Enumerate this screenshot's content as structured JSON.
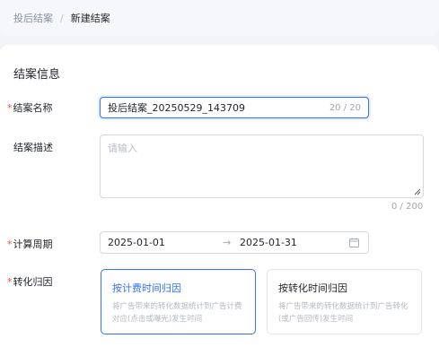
{
  "breadcrumb": {
    "parent": "投后结案",
    "separator": "/",
    "current": "新建结案"
  },
  "section": {
    "title": "结案信息"
  },
  "form": {
    "name": {
      "label": "结案名称",
      "required": "*",
      "value": "投后结案_20250529_143709",
      "count": "20 / 20"
    },
    "description": {
      "label": "结案描述",
      "placeholder": "请输入",
      "count": "0 / 200"
    },
    "period": {
      "label": "计算周期",
      "required": "*",
      "start": "2025-01-01",
      "arrow": "→",
      "end": "2025-01-31"
    },
    "attribution": {
      "label": "转化归因",
      "required": "*",
      "options": [
        {
          "title": "按计费时间归因",
          "desc": "将广告带来的转化数据统计到广告计费对应(点击或曝光)发生时间",
          "selected": true
        },
        {
          "title": "按转化时间归因",
          "desc": "将广告带来的转化数据统计到广告转化(或广告回传)发生时间",
          "selected": false
        }
      ]
    }
  },
  "colors": {
    "accent": "#3370ff",
    "required": "#f54a45",
    "placeholder": "#b8bdc6"
  },
  "icons": {
    "calendar": "calendar-icon",
    "arrow": "arrow-right-icon"
  }
}
